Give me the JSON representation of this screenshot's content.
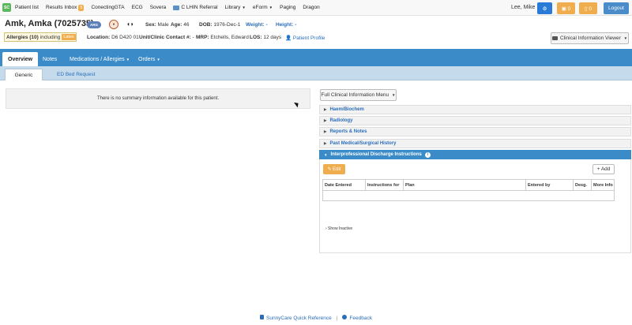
{
  "topnav": {
    "logo_text": "SC",
    "items": [
      {
        "label": "Patient list"
      },
      {
        "label": "Results Inbox",
        "badge": "5"
      },
      {
        "label": "ConectingGTA"
      },
      {
        "label": "ECG"
      },
      {
        "label": "Sovera"
      },
      {
        "label": "C LHIN Referral"
      },
      {
        "label": "Library"
      },
      {
        "label": "eForm"
      },
      {
        "label": "Paging"
      },
      {
        "label": "Dragon"
      }
    ],
    "user": "Lee, Mike",
    "btn_settings": "⚙",
    "btn_calendar": "▣ 0",
    "btn_alerts": "▯ 0",
    "btn_logout": "Logout"
  },
  "patient": {
    "name": "Amk, Amka (7025735)",
    "arg_badge": "ARG",
    "sex_label": "Sex:",
    "sex": "Male",
    "age_label": "Age:",
    "age": "46",
    "dob_label": "DOB:",
    "dob": "1976-Dec-1",
    "weight_label": "Weight: -",
    "height_label": "Height: -",
    "allergies_label": "Allergies (10)",
    "allergies_including": "including",
    "allergy_badge": "Latex",
    "location_label": "Location:",
    "location": "D6 D420 01",
    "contact_label": "Unit/Clinic Contact #:",
    "contact": "-",
    "mrp_label": "MRP:",
    "mrp": "Etchells, Edward",
    "los_label": "LOS:",
    "los": "12 days",
    "profile_link": "Patient Profile",
    "civ_button": "Clinical Information Viewer"
  },
  "main_tabs": [
    {
      "label": "Overview"
    },
    {
      "label": "Notes"
    },
    {
      "label": "Medications / Allergies"
    },
    {
      "label": "Orders"
    }
  ],
  "sub_tabs": [
    {
      "label": "Generic"
    },
    {
      "label": "ED Bed Request"
    }
  ],
  "summary_text": "There is no summary information available for this patient.",
  "right_panel": {
    "menu_button": "Full Clinical Information Menu",
    "sections": [
      {
        "label": "Haem/Biochem"
      },
      {
        "label": "Radiology"
      },
      {
        "label": "Reports & Notes"
      },
      {
        "label": "Past Medical/Surgical History"
      },
      {
        "label": "Interprofessional Discharge Instructions"
      }
    ],
    "edit_button": "Edit",
    "add_button": "+ Add",
    "table_headers": [
      "Date Entered",
      "Instructions for",
      "Plan",
      "Entered by",
      "Desg.",
      "More Info"
    ],
    "show_inactive": "› Show Inactive"
  },
  "footer": {
    "quick_ref": "SunnyCare Quick Reference",
    "separator": "|",
    "feedback": "Feedback"
  }
}
